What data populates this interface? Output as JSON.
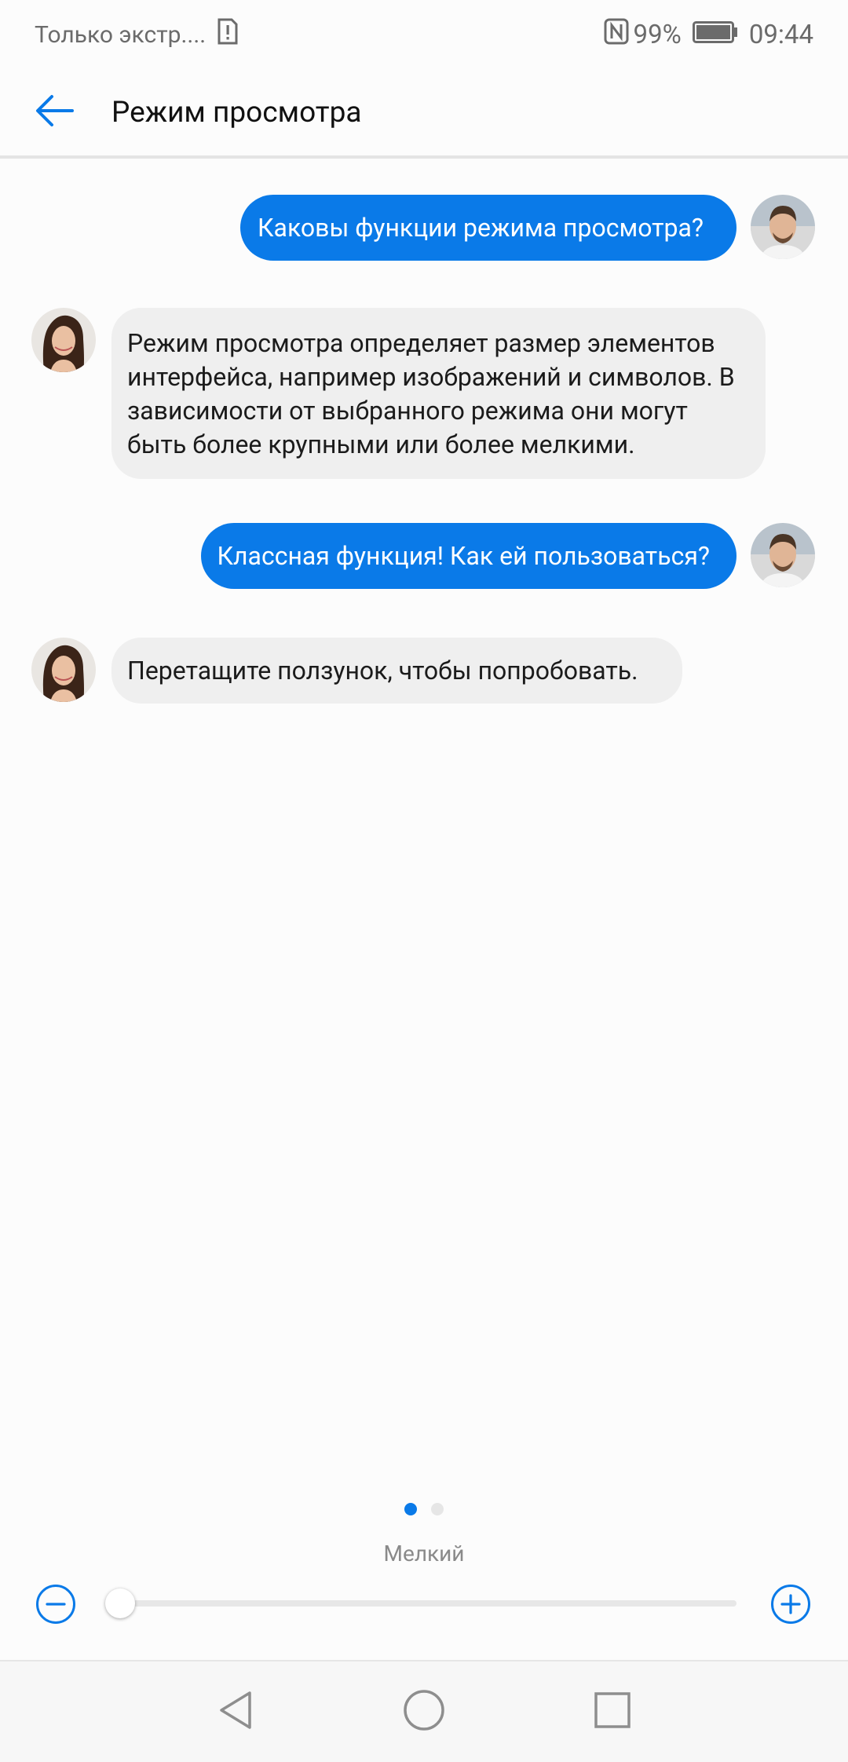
{
  "status_bar": {
    "carrier_text": "Только экстр....",
    "battery_percent": "99%",
    "time": "09:44",
    "icons": [
      "sim-alert-icon",
      "nfc-icon",
      "battery-icon"
    ]
  },
  "app_bar": {
    "title": "Режим просмотра",
    "back_icon": "arrow-left-icon"
  },
  "conversation": [
    {
      "sender": "user",
      "text": "Каковы функции режима просмотра?"
    },
    {
      "sender": "assistant",
      "text": "Режим просмотра определяет размер элементов интерфейса, например изображений и символов. В зависимости от выбранного режима они могут быть более крупными или более мелкими."
    },
    {
      "sender": "user",
      "text": "Классная функция! Как ей пользоваться?"
    },
    {
      "sender": "assistant",
      "text": "Перетащите ползунок, чтобы попробовать."
    }
  ],
  "pager": {
    "pages": 2,
    "active_index": 0
  },
  "size_control": {
    "label": "Мелкий",
    "decrease_icon": "minus-circle-icon",
    "increase_icon": "plus-circle-icon",
    "slider_value": 0
  },
  "nav_bar": {
    "icons": [
      "back-triangle-icon",
      "home-circle-icon",
      "recents-square-icon"
    ]
  },
  "colors": {
    "accent": "#0a7ae8",
    "incoming_bubble": "#efefef",
    "background": "#fcfcfc"
  }
}
